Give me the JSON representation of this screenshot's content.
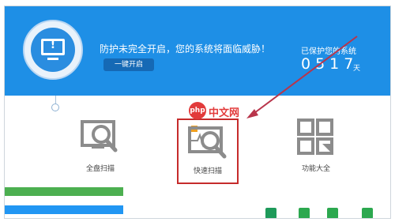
{
  "header": {
    "warning": "防护未完全开启，您的系统将面临威胁！",
    "enable_button": "一键开启",
    "protected_label": "已保护您的系统",
    "days": "0517",
    "day_unit": "天"
  },
  "features": [
    {
      "label": "全盘扫描",
      "icon": "monitor-magnifier-icon"
    },
    {
      "label": "快速扫描",
      "icon": "monitor-pulse-magnifier-icon"
    },
    {
      "label": "功能大全",
      "icon": "grid-apps-icon"
    }
  ],
  "overlay": {
    "php_logo": "php",
    "php_text": "中文网"
  },
  "colors": {
    "header_blue": "#1e8fe6",
    "highlight_red": "#c62b2b",
    "arrow_red": "#b8354b"
  }
}
